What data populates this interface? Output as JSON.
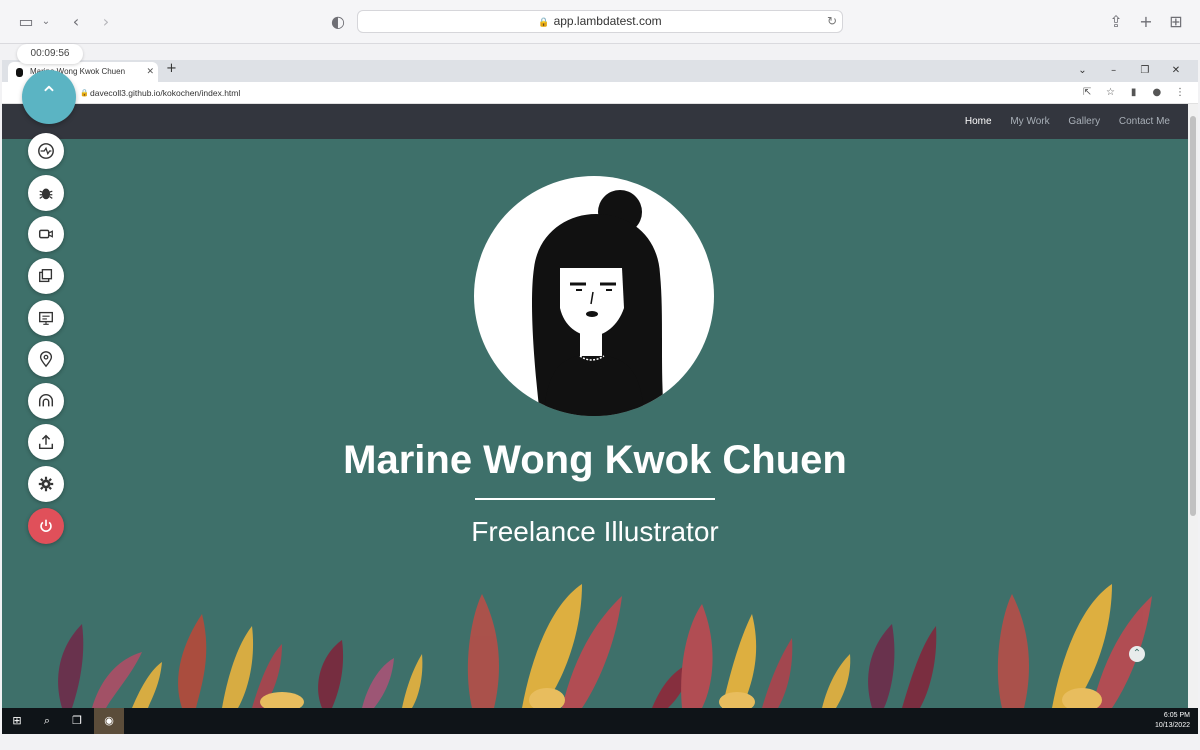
{
  "safari": {
    "address": "app.lambdatest.com"
  },
  "session": {
    "timer": "00:09:56"
  },
  "chrome": {
    "tab_title": "Marine Wong Kwok Chuen",
    "url": "davecoll3.github.io/kokochen/index.html"
  },
  "site": {
    "nav": [
      "Home",
      "My Work",
      "Gallery",
      "Contact Me"
    ],
    "active_nav": "Home",
    "name": "Marine Wong Kwok Chuen",
    "tagline": "Freelance Illustrator"
  },
  "toolbar": {
    "tools": [
      "network-throttle-icon",
      "bug-icon",
      "video-camera-icon",
      "screenshot-icon",
      "resolution-icon",
      "location-pin-icon",
      "tunnel-icon",
      "upload-icon",
      "settings-icon",
      "power-icon"
    ]
  },
  "taskbar": {
    "time": "6:05 PM",
    "date": "10/13/2022"
  },
  "colors": {
    "page_bg": "#3e706a",
    "nav_bg": "#33363e",
    "fab": "#5bb4c3",
    "power": "#e0505a"
  }
}
